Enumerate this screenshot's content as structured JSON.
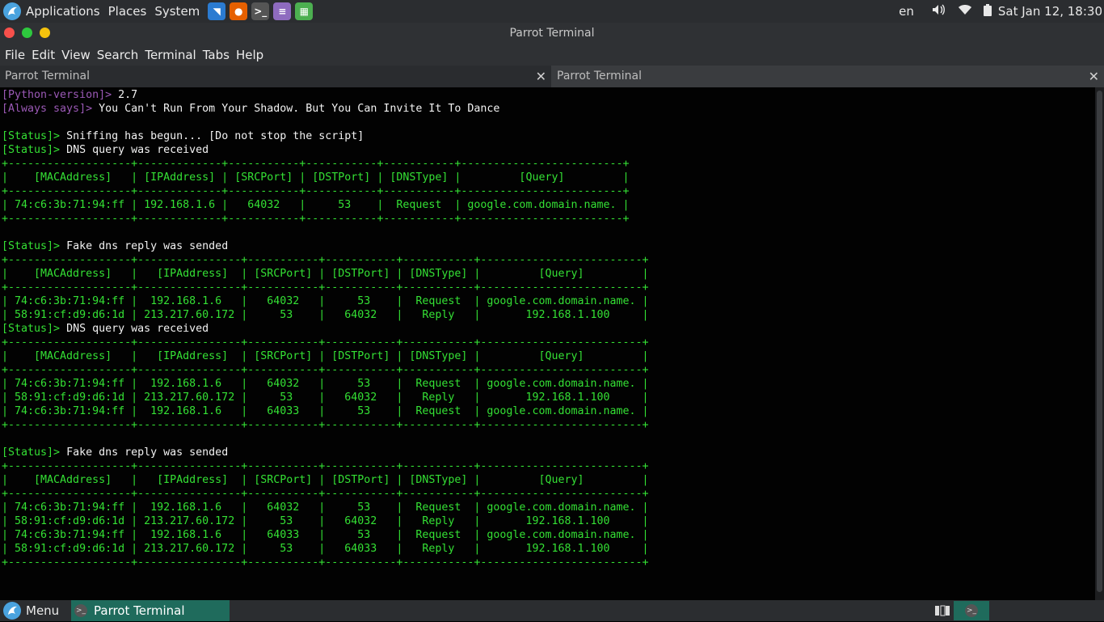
{
  "top_panel": {
    "applications": "Applications",
    "places": "Places",
    "system": "System",
    "keyboard_layout": "en",
    "datetime": "Sat Jan 12, 18:30",
    "launchers": [
      {
        "name": "vscode-icon",
        "color": "#2b7bd1",
        "glyph": "◥"
      },
      {
        "name": "firefox-icon",
        "color": "#e66000",
        "glyph": "●"
      },
      {
        "name": "terminal-icon",
        "color": "#555555",
        "glyph": ">_"
      },
      {
        "name": "text-editor-icon",
        "color": "#8e6bbf",
        "glyph": "≡"
      },
      {
        "name": "system-monitor-icon",
        "color": "#4caf50",
        "glyph": "▦"
      }
    ]
  },
  "window": {
    "title": "Parrot Terminal",
    "button_colors": {
      "close": "#f8504b",
      "minimize": "#2ec83e",
      "maximize": "#f4c20d"
    }
  },
  "menubar": [
    "File",
    "Edit",
    "View",
    "Search",
    "Terminal",
    "Tabs",
    "Help"
  ],
  "tabs": [
    {
      "label": "Parrot Terminal",
      "close": "✕"
    },
    {
      "label": "Parrot Terminal",
      "close": "✕"
    }
  ],
  "terminal": {
    "colors": {
      "prompt": "#9b59b6",
      "output": "#34e034",
      "text": "#f2f2f2"
    },
    "lines": [
      [
        {
          "t": "[Python-version]> ",
          "c": "p"
        },
        {
          "t": "2.7",
          "c": "w"
        }
      ],
      [
        {
          "t": "[Always says]> ",
          "c": "p"
        },
        {
          "t": "You Can't Run From Your Shadow. But You Can Invite It To Dance",
          "c": "w"
        }
      ],
      [],
      [
        {
          "t": "[Status]> ",
          "c": "g"
        },
        {
          "t": "Sniffing has begun... [Do not stop the script]",
          "c": "w"
        }
      ],
      [
        {
          "t": "[Status]> ",
          "c": "g"
        },
        {
          "t": "DNS query was received",
          "c": "w"
        }
      ],
      [
        {
          "t": "+-------------------+-------------+-----------+-----------+-----------+-------------------------+",
          "c": "g"
        }
      ],
      [
        {
          "t": "|    [MACAddress]   | [IPAddress] | [SRCPort] | [DSTPort] | [DNSType] |         [Query]         |",
          "c": "g"
        }
      ],
      [
        {
          "t": "+-------------------+-------------+-----------+-----------+-----------+-------------------------+",
          "c": "g"
        }
      ],
      [
        {
          "t": "| 74:c6:3b:71:94:ff | 192.168.1.6 |   64032   |     53    |  Request  | google.com.domain.name. |",
          "c": "g"
        }
      ],
      [
        {
          "t": "+-------------------+-------------+-----------+-----------+-----------+-------------------------+",
          "c": "g"
        }
      ],
      [],
      [
        {
          "t": "[Status]> ",
          "c": "g"
        },
        {
          "t": "Fake dns reply was sended",
          "c": "w"
        }
      ],
      [
        {
          "t": "+-------------------+----------------+-----------+-----------+-----------+-------------------------+",
          "c": "g"
        }
      ],
      [
        {
          "t": "|    [MACAddress]   |   [IPAddress]  | [SRCPort] | [DSTPort] | [DNSType] |         [Query]         |",
          "c": "g"
        }
      ],
      [
        {
          "t": "+-------------------+----------------+-----------+-----------+-----------+-------------------------+",
          "c": "g"
        }
      ],
      [
        {
          "t": "| 74:c6:3b:71:94:ff |  192.168.1.6   |   64032   |     53    |  Request  | google.com.domain.name. |",
          "c": "g"
        }
      ],
      [
        {
          "t": "| 58:91:cf:d9:d6:1d | 213.217.60.172 |     53    |   64032   |   Reply   |       192.168.1.100     |",
          "c": "g"
        }
      ],
      [
        {
          "t": "[Status]> ",
          "c": "g"
        },
        {
          "t": "DNS query was received",
          "c": "w"
        }
      ],
      [
        {
          "t": "+-------------------+----------------+-----------+-----------+-----------+-------------------------+",
          "c": "g"
        }
      ],
      [
        {
          "t": "|    [MACAddress]   |   [IPAddress]  | [SRCPort] | [DSTPort] | [DNSType] |         [Query]         |",
          "c": "g"
        }
      ],
      [
        {
          "t": "+-------------------+----------------+-----------+-----------+-----------+-------------------------+",
          "c": "g"
        }
      ],
      [
        {
          "t": "| 74:c6:3b:71:94:ff |  192.168.1.6   |   64032   |     53    |  Request  | google.com.domain.name. |",
          "c": "g"
        }
      ],
      [
        {
          "t": "| 58:91:cf:d9:d6:1d | 213.217.60.172 |     53    |   64032   |   Reply   |       192.168.1.100     |",
          "c": "g"
        }
      ],
      [
        {
          "t": "| 74:c6:3b:71:94:ff |  192.168.1.6   |   64033   |     53    |  Request  | google.com.domain.name. |",
          "c": "g"
        }
      ],
      [
        {
          "t": "+-------------------+----------------+-----------+-----------+-----------+-------------------------+",
          "c": "g"
        }
      ],
      [],
      [
        {
          "t": "[Status]> ",
          "c": "g"
        },
        {
          "t": "Fake dns reply was sended",
          "c": "w"
        }
      ],
      [
        {
          "t": "+-------------------+----------------+-----------+-----------+-----------+-------------------------+",
          "c": "g"
        }
      ],
      [
        {
          "t": "|    [MACAddress]   |   [IPAddress]  | [SRCPort] | [DSTPort] | [DNSType] |         [Query]         |",
          "c": "g"
        }
      ],
      [
        {
          "t": "+-------------------+----------------+-----------+-----------+-----------+-------------------------+",
          "c": "g"
        }
      ],
      [
        {
          "t": "| 74:c6:3b:71:94:ff |  192.168.1.6   |   64032   |     53    |  Request  | google.com.domain.name. |",
          "c": "g"
        }
      ],
      [
        {
          "t": "| 58:91:cf:d9:d6:1d | 213.217.60.172 |     53    |   64032   |   Reply   |       192.168.1.100     |",
          "c": "g"
        }
      ],
      [
        {
          "t": "| 74:c6:3b:71:94:ff |  192.168.1.6   |   64033   |     53    |  Request  | google.com.domain.name. |",
          "c": "g"
        }
      ],
      [
        {
          "t": "| 58:91:cf:d9:d6:1d | 213.217.60.172 |     53    |   64033   |   Reply   |       192.168.1.100     |",
          "c": "g"
        }
      ],
      [
        {
          "t": "+-------------------+----------------+-----------+-----------+-----------+-------------------------+",
          "c": "g"
        }
      ]
    ]
  },
  "bottom_panel": {
    "menu_label": "Menu",
    "task_label": "Parrot Terminal"
  }
}
